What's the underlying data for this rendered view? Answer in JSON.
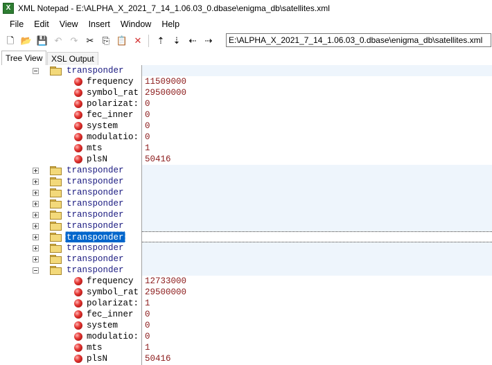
{
  "window": {
    "title": "XML Notepad - E:\\ALPHA_X_2021_7_14_1.06.03_0.dbase\\enigma_db\\satellites.xml",
    "app_icon_letter": "X"
  },
  "menu": [
    "File",
    "Edit",
    "View",
    "Insert",
    "Window",
    "Help"
  ],
  "toolbar": {
    "buttons": [
      {
        "name": "new-file-icon",
        "glyph": "🗋",
        "enabled": true
      },
      {
        "name": "open-folder-icon",
        "glyph": "📂",
        "enabled": true
      },
      {
        "name": "save-icon",
        "glyph": "💾",
        "enabled": true
      },
      {
        "name": "undo-icon",
        "glyph": "↶",
        "enabled": false
      },
      {
        "name": "redo-icon",
        "glyph": "↷",
        "enabled": false
      },
      {
        "name": "cut-icon",
        "glyph": "✂",
        "enabled": true
      },
      {
        "name": "copy-icon",
        "glyph": "⎘",
        "enabled": true
      },
      {
        "name": "paste-icon",
        "glyph": "📋",
        "enabled": true
      },
      {
        "name": "delete-icon",
        "glyph": "✕",
        "enabled": true,
        "color": "#d32f2f"
      },
      {
        "name": "nudge-up-icon",
        "glyph": "⇡",
        "enabled": true
      },
      {
        "name": "nudge-down-icon",
        "glyph": "⇣",
        "enabled": true
      },
      {
        "name": "nudge-left-icon",
        "glyph": "⇠",
        "enabled": true
      },
      {
        "name": "nudge-right-icon",
        "glyph": "⇢",
        "enabled": true
      }
    ],
    "path_value": "E:\\ALPHA_X_2021_7_14_1.06.03_0.dbase\\enigma_db\\satellites.xml"
  },
  "tabs": {
    "tree_view": "Tree View",
    "xsl_output": "XSL Output"
  },
  "tree": [
    {
      "kind": "element",
      "label": "transponder",
      "expander": "minus",
      "value": ""
    },
    {
      "kind": "attr",
      "label": "frequency",
      "value": "11509000"
    },
    {
      "kind": "attr",
      "label": "symbol_rat",
      "value": "29500000"
    },
    {
      "kind": "attr",
      "label": "polarizat:",
      "value": "0"
    },
    {
      "kind": "attr",
      "label": "fec_inner",
      "value": "0"
    },
    {
      "kind": "attr",
      "label": "system",
      "value": "0"
    },
    {
      "kind": "attr",
      "label": "modulatio:",
      "value": "0"
    },
    {
      "kind": "attr",
      "label": "mts",
      "value": "1"
    },
    {
      "kind": "attr",
      "label": "plsN",
      "value": "50416"
    },
    {
      "kind": "element",
      "label": "transponder",
      "expander": "plus",
      "value": ""
    },
    {
      "kind": "element",
      "label": "transponder",
      "expander": "plus",
      "value": ""
    },
    {
      "kind": "element",
      "label": "transponder",
      "expander": "plus",
      "value": ""
    },
    {
      "kind": "element",
      "label": "transponder",
      "expander": "plus",
      "value": ""
    },
    {
      "kind": "element",
      "label": "transponder",
      "expander": "plus",
      "value": ""
    },
    {
      "kind": "element",
      "label": "transponder",
      "expander": "plus",
      "value": ""
    },
    {
      "kind": "element",
      "label": "transponder",
      "expander": "plus",
      "value": "",
      "selected": true
    },
    {
      "kind": "element",
      "label": "transponder",
      "expander": "plus",
      "value": ""
    },
    {
      "kind": "element",
      "label": "transponder",
      "expander": "plus",
      "value": ""
    },
    {
      "kind": "element",
      "label": "transponder",
      "expander": "minus",
      "value": ""
    },
    {
      "kind": "attr",
      "label": "frequency",
      "value": "12733000"
    },
    {
      "kind": "attr",
      "label": "symbol_rat",
      "value": "29500000"
    },
    {
      "kind": "attr",
      "label": "polarizat:",
      "value": "1"
    },
    {
      "kind": "attr",
      "label": "fec_inner",
      "value": "0"
    },
    {
      "kind": "attr",
      "label": "system",
      "value": "0"
    },
    {
      "kind": "attr",
      "label": "modulatio:",
      "value": "0"
    },
    {
      "kind": "attr",
      "label": "mts",
      "value": "1"
    },
    {
      "kind": "attr",
      "label": "plsN",
      "value": "50416"
    }
  ]
}
